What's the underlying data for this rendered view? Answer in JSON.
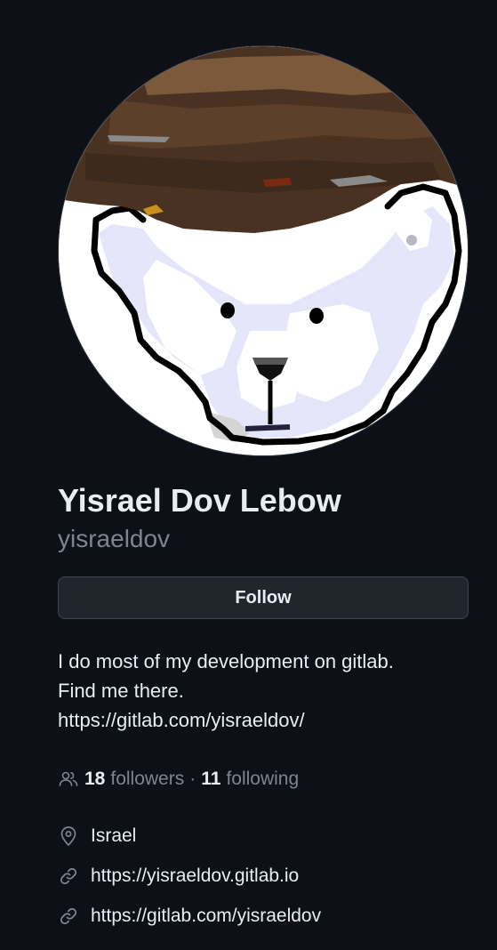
{
  "profile": {
    "fullname": "Yisrael Dov Lebow",
    "username": "yisraeldov",
    "follow_label": "Follow",
    "bio_lines": [
      "I do most of my development on gitlab.",
      "Find me there.",
      "https://gitlab.com/yisraeldov/"
    ]
  },
  "stats": {
    "followers_count": "18",
    "followers_label": "followers",
    "separator": "·",
    "following_count": "11",
    "following_label": "following"
  },
  "details": {
    "location": "Israel",
    "website": "https://yisraeldov.gitlab.io",
    "social": "https://gitlab.com/yisraeldov"
  },
  "icons": {
    "people": "people-icon",
    "location": "location-pin-icon",
    "link": "link-icon"
  },
  "colors": {
    "background": "#0d1117",
    "text_primary": "#e6edf3",
    "text_muted": "#7d8590",
    "button_bg": "#21262d",
    "button_border": "#3d444d"
  }
}
